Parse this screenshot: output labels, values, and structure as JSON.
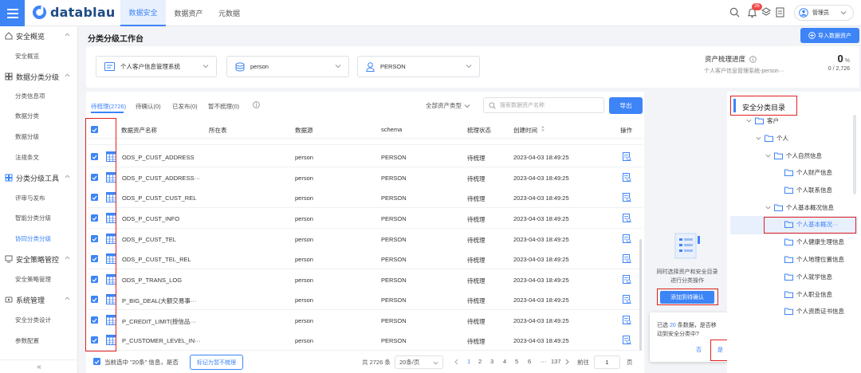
{
  "app": {
    "logo": "datablau",
    "user_name": "管理员",
    "notification_count": "26"
  },
  "nav": [
    "数据安全",
    "数据资产",
    "元数据"
  ],
  "sidebar": {
    "groups": [
      {
        "label": "安全概览",
        "items": [
          "安全概览"
        ]
      },
      {
        "label": "数据分类分级",
        "items": [
          "分类信息项",
          "数据分类",
          "数据分级",
          "法规条文"
        ]
      },
      {
        "label": "分类分级工具",
        "items": [
          "评审与发布",
          "智能分类分级",
          "协同分类分级"
        ]
      },
      {
        "label": "安全策略管控",
        "items": [
          "安全策略管理"
        ]
      },
      {
        "label": "系统管理",
        "items": [
          "安全分类设计",
          "参数配置"
        ]
      }
    ],
    "collapse": "«"
  },
  "page": {
    "title": "分类分级工作台",
    "import_button": "导入数据资产"
  },
  "filters": {
    "system": "个人客户信息管理系统",
    "db": "person",
    "schema": "PERSON"
  },
  "progress": {
    "label": "资产梳理进度",
    "value": "0",
    "unit": "%",
    "subtitle": "个人客户信息管理系统-person···",
    "count": "0 / 2,726"
  },
  "tabs": [
    "待梳理(2726)",
    "待确认(0)",
    "已发布(0)",
    "暂不梳理(0)"
  ],
  "toolbar": {
    "asset_type": "全部资产类型",
    "search_placeholder": "搜索数据资产名称",
    "export": "导出"
  },
  "table": {
    "headers": [
      "数据资产名称",
      "所在表",
      "数据源",
      "schema",
      "梳理状态",
      "创建时间",
      "操作"
    ],
    "rows": [
      {
        "name": "ODS_P_CUST_ADDRESS",
        "db": "person",
        "schema": "PERSON",
        "status": "待梳理",
        "time": "2023-04-03 18:49:25"
      },
      {
        "name": "ODS_P_CUST_ADDRESS···",
        "db": "person",
        "schema": "PERSON",
        "status": "待梳理",
        "time": "2023-04-03 18:49:25"
      },
      {
        "name": "ODS_P_CUST_CUST_REL",
        "db": "person",
        "schema": "PERSON",
        "status": "待梳理",
        "time": "2023-04-03 18:49:25"
      },
      {
        "name": "ODS_P_CUST_INFO",
        "db": "person",
        "schema": "PERSON",
        "status": "待梳理",
        "time": "2023-04-03 18:49:25"
      },
      {
        "name": "ODS_P_CUST_TEL",
        "db": "person",
        "schema": "PERSON",
        "status": "待梳理",
        "time": "2023-04-03 18:49:25"
      },
      {
        "name": "ODS_P_CUST_TEL_REL",
        "db": "person",
        "schema": "PERSON",
        "status": "待梳理",
        "time": "2023-04-03 18:49:25"
      },
      {
        "name": "ODS_P_TRANS_LOG",
        "db": "person",
        "schema": "PERSON",
        "status": "待梳理",
        "time": "2023-04-03 18:49:25"
      },
      {
        "name": "P_BIG_DEAL(大额交易事···",
        "db": "person",
        "schema": "PERSON",
        "status": "待梳理",
        "time": "2023-04-03 18:49:25"
      },
      {
        "name": "P_CREDIT_LIMIT(授信品···",
        "db": "person",
        "schema": "PERSON",
        "status": "待梳理",
        "time": "2023-04-03 18:49:25"
      },
      {
        "name": "P_CUSTOMER_LEVEL_IN···",
        "db": "person",
        "schema": "PERSON",
        "status": "待梳理",
        "time": "2023-04-03 18:49:25"
      }
    ]
  },
  "footer": {
    "selected_text": "当前选中 \"20条\" 信息，是否",
    "mark_button": "标记为暂不梳理",
    "total": "共 2726 条",
    "page_size": "20条/页",
    "pages": [
      "1",
      "2",
      "3",
      "4",
      "5",
      "6",
      "···",
      "137"
    ],
    "goto": "前往",
    "goto_value": "1",
    "page_unit": "页"
  },
  "middle": {
    "hint_line1": "同时选择资产和安全目录",
    "hint_line2": "进行分类操作",
    "add_button": "添加到待确认"
  },
  "confirm": {
    "line1_prefix": "已选",
    "count": "20",
    "line1_suffix": "条数据，是否移",
    "line2": "动到安全分类中?",
    "no": "否",
    "yes": "是"
  },
  "tree": {
    "title": "安全分类目录",
    "nodes": [
      "客户",
      "个人",
      "个人自然信息",
      "个人财产信息",
      "个人联系信息",
      "个人基本概况信息",
      "个人基本概况···",
      "个人健康生理信息",
      "个人地理位置信息",
      "个人就学信息",
      "个人职业信息",
      "个人资质证书信息"
    ]
  },
  "colors": {
    "primary": "#3d84f7",
    "highlight": "#e02020",
    "sidebar_active": "#3d84f7"
  }
}
